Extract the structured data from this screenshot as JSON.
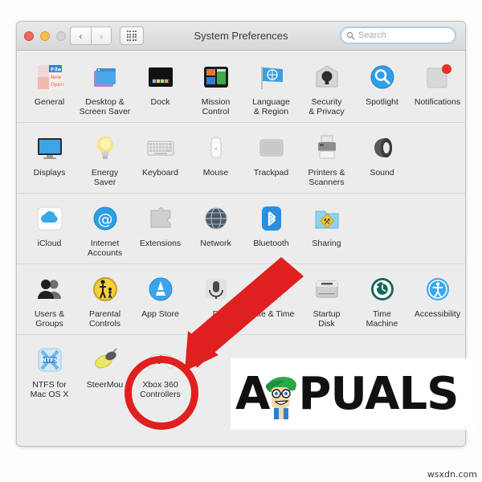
{
  "window": {
    "title": "System Preferences",
    "traffic_lights": [
      "close",
      "minimize",
      "zoom-disabled"
    ],
    "nav": {
      "back": "‹",
      "forward": "›"
    },
    "grid_button": "show-all-grid"
  },
  "search": {
    "placeholder": "Search",
    "value": "",
    "clear_label": "✕"
  },
  "rows": [
    {
      "items": [
        {
          "label": "General",
          "icon": "general-icon"
        },
        {
          "label": "Desktop &\nScreen Saver",
          "icon": "desktop-screensaver-icon"
        },
        {
          "label": "Dock",
          "icon": "dock-icon"
        },
        {
          "label": "Mission\nControl",
          "icon": "mission-control-icon"
        },
        {
          "label": "Language\n& Region",
          "icon": "language-region-icon"
        },
        {
          "label": "Security\n& Privacy",
          "icon": "security-privacy-icon"
        },
        {
          "label": "Spotlight",
          "icon": "spotlight-icon"
        },
        {
          "label": "Notifications",
          "icon": "notifications-icon"
        }
      ]
    },
    {
      "items": [
        {
          "label": "Displays",
          "icon": "displays-icon"
        },
        {
          "label": "Energy\nSaver",
          "icon": "energy-saver-icon"
        },
        {
          "label": "Keyboard",
          "icon": "keyboard-icon"
        },
        {
          "label": "Mouse",
          "icon": "mouse-icon"
        },
        {
          "label": "Trackpad",
          "icon": "trackpad-icon"
        },
        {
          "label": "Printers &\nScanners",
          "icon": "printers-scanners-icon"
        },
        {
          "label": "Sound",
          "icon": "sound-icon"
        }
      ]
    },
    {
      "items": [
        {
          "label": "iCloud",
          "icon": "icloud-icon"
        },
        {
          "label": "Internet\nAccounts",
          "icon": "internet-accounts-icon"
        },
        {
          "label": "Extensions",
          "icon": "extensions-icon"
        },
        {
          "label": "Network",
          "icon": "network-icon"
        },
        {
          "label": "Bluetooth",
          "icon": "bluetooth-icon"
        },
        {
          "label": "Sharing",
          "icon": "sharing-icon"
        }
      ]
    },
    {
      "items": [
        {
          "label": "Users &\nGroups",
          "icon": "users-groups-icon"
        },
        {
          "label": "Parental\nControls",
          "icon": "parental-controls-icon"
        },
        {
          "label": "App Store",
          "icon": "app-store-icon"
        },
        {
          "label": "D\n&",
          "icon": "dictation-speech-icon"
        },
        {
          "label": "Date & Time",
          "icon": "date-time-icon"
        },
        {
          "label": "Startup\nDisk",
          "icon": "startup-disk-icon"
        },
        {
          "label": "Time\nMachine",
          "icon": "time-machine-icon"
        },
        {
          "label": "Accessibility",
          "icon": "accessibility-icon"
        }
      ]
    },
    {
      "items": [
        {
          "label": "NTFS for\nMac OS X",
          "icon": "ntfs-icon"
        },
        {
          "label": "SteerMou",
          "icon": "steermouse-icon"
        },
        {
          "label": "Xbox 360\nControllers",
          "icon": "xbox-360-controllers-icon"
        }
      ]
    }
  ],
  "annotations": {
    "circle_color": "#e01f1f",
    "arrow_color": "#e02020",
    "circle_target": "Xbox 360 Controllers"
  },
  "watermarks": {
    "appuals": "PUALS",
    "appuals_initial": "A",
    "site": "wsxdn.com"
  }
}
